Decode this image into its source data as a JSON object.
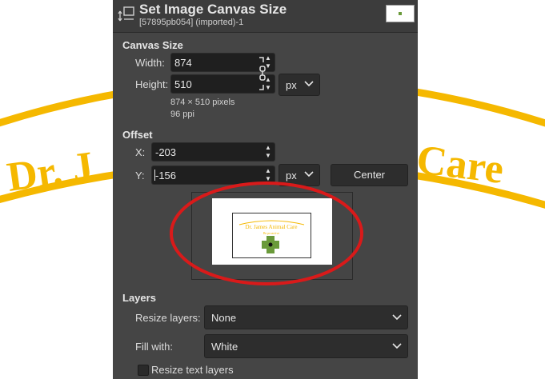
{
  "dialog": {
    "title": "Set Image Canvas Size",
    "subtitle": "[57895pb054] (imported)-1"
  },
  "canvas_size": {
    "section_label": "Canvas Size",
    "width_label": "Width:",
    "width_value": "874",
    "height_label": "Height:",
    "height_value": "510",
    "unit": "px",
    "pixels_info": "874 × 510 pixels",
    "ppi_info": "96 ppi"
  },
  "offset": {
    "section_label": "Offset",
    "x_label": "X:",
    "x_value": "-203",
    "y_label": "Y:",
    "y_value": "-156",
    "unit": "px",
    "center_label": "Center"
  },
  "preview": {
    "logo_text": "Dr. James Animal Care",
    "logo_subtext": "Be proactive"
  },
  "layers": {
    "section_label": "Layers",
    "resize_layers_label": "Resize layers:",
    "resize_layers_value": "None",
    "fill_with_label": "Fill with:",
    "fill_with_value": "White",
    "resize_text_label": "Resize text layers",
    "resize_text_checked": false
  },
  "background": {
    "left_text": "Dr. J",
    "right_text": "Care",
    "color": "#f5b800"
  },
  "annotation": {
    "color": "#d91a1a"
  }
}
